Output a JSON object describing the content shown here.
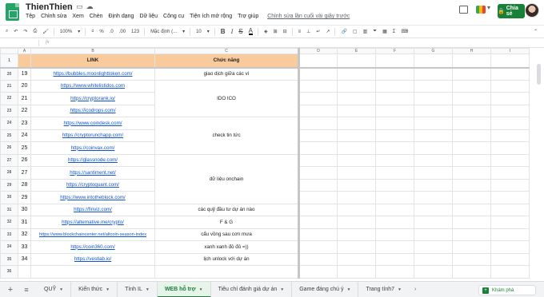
{
  "app": {
    "doc_title": "ThienThien",
    "menu": [
      "Tệp",
      "Chỉnh sửa",
      "Xem",
      "Chèn",
      "Định dạng",
      "Dữ liệu",
      "Công cụ",
      "Tiện ích mở rộng",
      "Trợ giúp"
    ],
    "last_edit": "Chỉnh sửa lần cuối vài giây trước",
    "share_label": "Chia sẻ"
  },
  "toolbar": {
    "zoom": "100%",
    "currency": "₫",
    "percent": "%",
    "decimal_less": ".0",
    "decimal_more": ".00",
    "number_format": "123",
    "font": "Mặc định (...",
    "font_size": "10",
    "bold": "B",
    "italic": "I",
    "strike": "S",
    "text_color": "A"
  },
  "formula": {
    "fx": "fx",
    "value": ""
  },
  "sheet": {
    "columns": [
      "A",
      "B",
      "C",
      "D",
      "E",
      "F",
      "G",
      "H",
      "I"
    ],
    "header": {
      "row": "1",
      "link": "LINK",
      "function": "Chức năng"
    },
    "rows": [
      {
        "row": "20",
        "idx": "19",
        "link": "https://bubbles.moonlighttoken.com/",
        "function": "giao dịch giữa các ví"
      },
      {
        "row": "21",
        "idx": "20",
        "link": "https://www.whitelistidos.com",
        "function": ""
      },
      {
        "row": "22",
        "idx": "21",
        "link": "https://cryptorank.io/",
        "function": "IDO ICO"
      },
      {
        "row": "23",
        "idx": "22",
        "link": "https://icodrops.com/",
        "function": ""
      },
      {
        "row": "24",
        "idx": "23",
        "link": "https://www.coindesk.com/",
        "function": ""
      },
      {
        "row": "25",
        "idx": "24",
        "link": "https://cryptorunchapp.com/",
        "function": "check tin tức"
      },
      {
        "row": "26",
        "idx": "25",
        "link": "https://coinvax.com/",
        "function": ""
      },
      {
        "row": "27",
        "idx": "26",
        "link": "https://glassnode.com/",
        "function": ""
      },
      {
        "row": "28",
        "idx": "27",
        "link": "https://santiment.net/",
        "function": "dữ liệu onchain"
      },
      {
        "row": "29",
        "idx": "28",
        "link": "https://cryptoquant.com/",
        "function": ""
      },
      {
        "row": "30",
        "idx": "29",
        "link": "https://www.intotheblock.com/",
        "function": ""
      },
      {
        "row": "31",
        "idx": "30",
        "link": "https://finviz.com/",
        "function": "các quỹ đầu tư dự án nào"
      },
      {
        "row": "32",
        "idx": "31",
        "link": "https://alternative.me/crypto/",
        "function": "F & G"
      },
      {
        "row": "33",
        "idx": "32",
        "link": "https://www.blockchaincenter.net/altcoin-season-index",
        "function": "cẩu vồng sau cơn mưa"
      },
      {
        "row": "34",
        "idx": "33",
        "link": "https://coin360.com/",
        "function": "xanh xanh đỏ đỏ =))"
      },
      {
        "row": "35",
        "idx": "34",
        "link": "https://vestlab.io/",
        "function": "lịch unlock với dự án"
      },
      {
        "row": "36",
        "idx": "",
        "link": "",
        "function": ""
      }
    ]
  },
  "tabs": [
    {
      "label": "QUỸ",
      "active": false
    },
    {
      "label": "Kiến thức",
      "active": false
    },
    {
      "label": "Tính IL",
      "active": false
    },
    {
      "label": "WEB hỗ trợ",
      "active": true
    },
    {
      "label": "Tiêu chí đánh giá dự án",
      "active": false
    },
    {
      "label": "Game đáng chú ý",
      "active": false
    },
    {
      "label": "Trang tính7",
      "active": false
    }
  ],
  "explore_label": "Khám phá",
  "colors": {
    "header_fill": "#f9cb9c",
    "link": "#1155cc",
    "brand_green": "#188038"
  }
}
